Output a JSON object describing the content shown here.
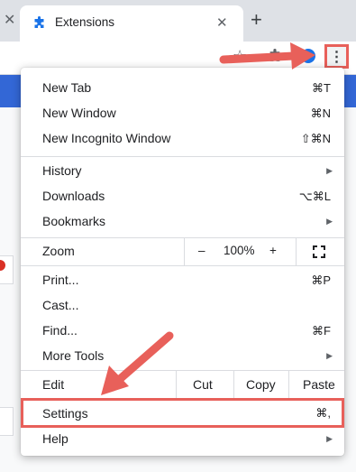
{
  "tab": {
    "title": "Extensions",
    "close_icon": "✕",
    "prev_close_icon": "✕"
  },
  "newtab": {
    "icon": "+"
  },
  "toolbar": {
    "menu_icon": "⋮",
    "star_icon": "☆",
    "puzzle_icon": "puzzle-icon"
  },
  "menu": {
    "new_tab": {
      "label": "New Tab",
      "shortcut": "⌘T"
    },
    "new_window": {
      "label": "New Window",
      "shortcut": "⌘N"
    },
    "new_incognito": {
      "label": "New Incognito Window",
      "shortcut": "⇧⌘N"
    },
    "history": {
      "label": "History"
    },
    "downloads": {
      "label": "Downloads",
      "shortcut": "⌥⌘L"
    },
    "bookmarks": {
      "label": "Bookmarks"
    },
    "zoom": {
      "label": "Zoom",
      "minus": "–",
      "value": "100%",
      "plus": "+"
    },
    "print": {
      "label": "Print...",
      "shortcut": "⌘P"
    },
    "cast": {
      "label": "Cast..."
    },
    "find": {
      "label": "Find...",
      "shortcut": "⌘F"
    },
    "more_tools": {
      "label": "More Tools"
    },
    "edit": {
      "label": "Edit",
      "cut": "Cut",
      "copy": "Copy",
      "paste": "Paste"
    },
    "settings": {
      "label": "Settings",
      "shortcut": "⌘,"
    },
    "help": {
      "label": "Help"
    },
    "submenu_arrow": "▶"
  },
  "colors": {
    "annotation": "#e8605a",
    "profile": "#1a73e8",
    "banner": "#3367d6"
  }
}
